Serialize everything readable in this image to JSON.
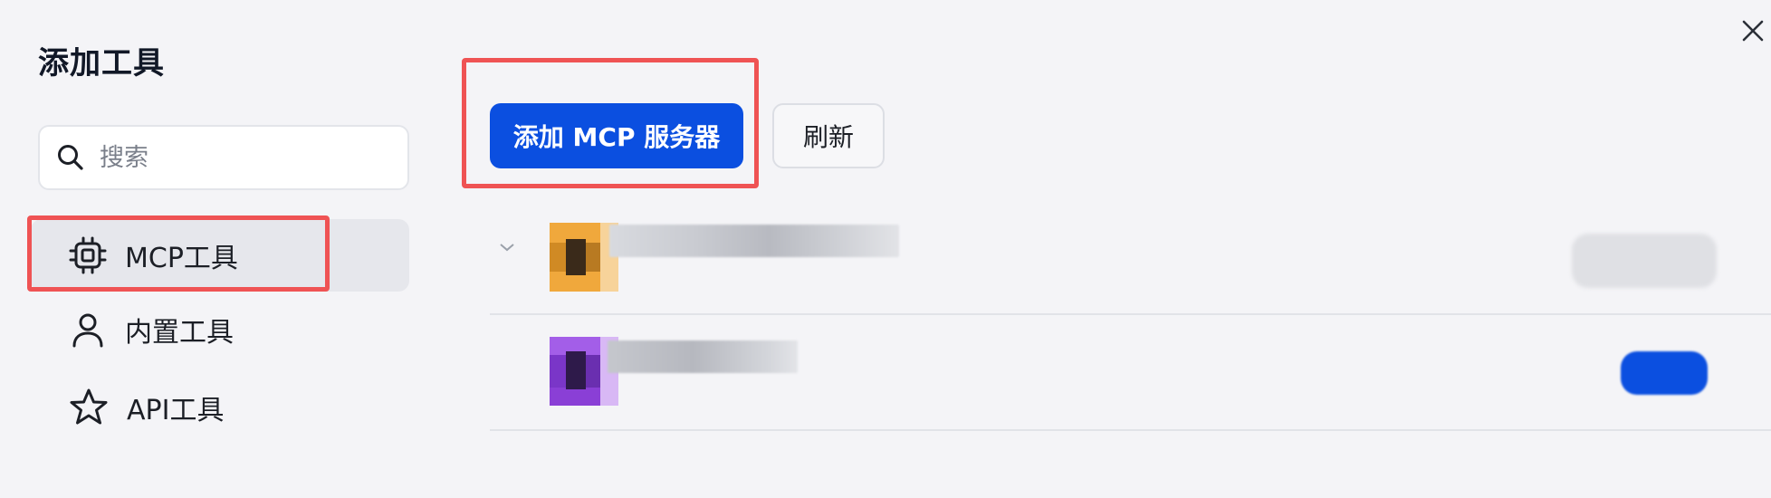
{
  "sidebar": {
    "title": "添加工具",
    "search": {
      "placeholder": "搜索",
      "value": ""
    },
    "items": [
      {
        "label": "MCP工具",
        "icon": "chip-icon",
        "active": true
      },
      {
        "label": "内置工具",
        "icon": "user-icon",
        "active": false
      },
      {
        "label": "API工具",
        "icon": "star-icon",
        "active": false
      }
    ]
  },
  "toolbar": {
    "add_label": "添加 MCP 服务器",
    "refresh_label": "刷新"
  },
  "tools": [
    {
      "name": "",
      "status": "",
      "icon_color": "#f0a83c"
    },
    {
      "name": "",
      "status": "",
      "icon_color": "#8a3fd6"
    }
  ],
  "colors": {
    "primary": "#0b4fe0",
    "highlight": "#ef5354",
    "active_bg": "#e6e7ec",
    "background": "#f4f4f7"
  }
}
